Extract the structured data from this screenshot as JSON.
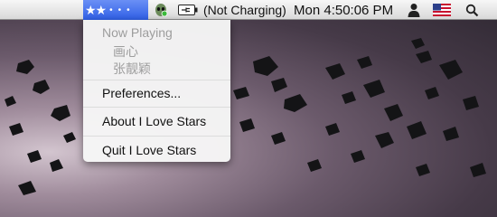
{
  "menubar": {
    "app_icon": "stars-icon",
    "battery_status": "(Not Charging)",
    "clock": "Mon 4:50:06 PM",
    "icons": [
      "alien-icon",
      "battery-icon",
      "user-icon",
      "us-flag-icon",
      "spotlight-icon"
    ]
  },
  "menu": {
    "now_playing_header": "Now Playing",
    "track_title": "画心",
    "track_artist": "张靓颖",
    "preferences": "Preferences...",
    "about": "About I Love Stars",
    "quit": "Quit I Love Stars"
  },
  "colors": {
    "menubar_highlight": "#3d6bec",
    "menu_bg": "#f6f6f6",
    "disabled_text": "#9d9d9d",
    "wallpaper_tone": "#5c4b5f"
  }
}
